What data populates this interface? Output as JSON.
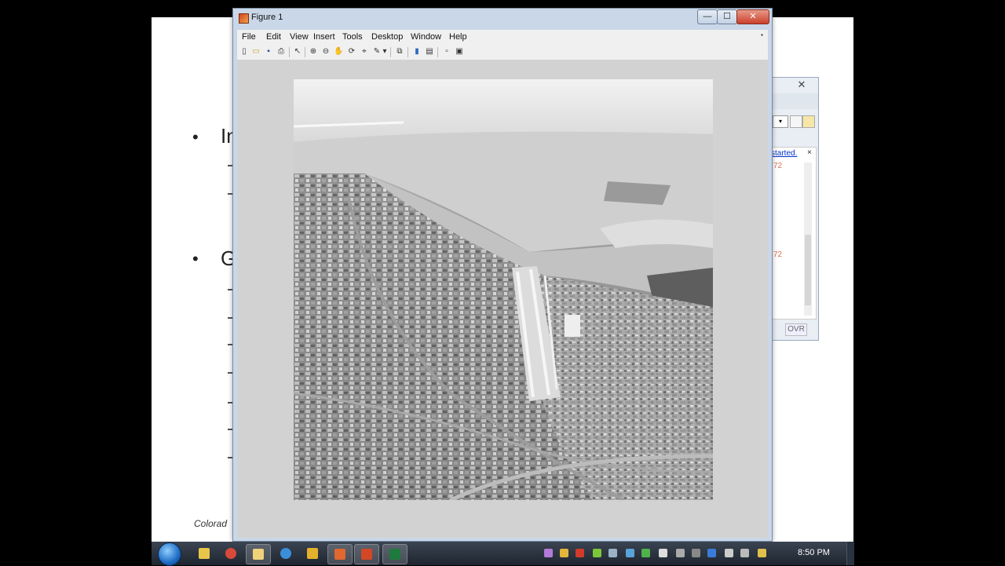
{
  "slide": {
    "bullets": [
      {
        "glyph": "•",
        "text": "In"
      },
      {
        "glyph": "•",
        "text": "G"
      }
    ],
    "footer_text": "Colorad"
  },
  "back_window": {
    "close_glyph": "✕",
    "link_text": "started.",
    "close_pane_glyph": "×",
    "red_text_1": "72",
    "red_text_2": "72",
    "status_ovr": "OVR"
  },
  "figure_window": {
    "title": "Figure 1",
    "controls": {
      "minimize": "—",
      "maximize": "☐",
      "close": "✕"
    },
    "menu": [
      "File",
      "Edit",
      "View",
      "Insert",
      "Tools",
      "Desktop",
      "Window",
      "Help"
    ],
    "menu_corner_glyph": "▪",
    "toolbar": [
      {
        "name": "new-figure-icon",
        "glyph": "▯"
      },
      {
        "name": "open-file-icon",
        "glyph": "▭"
      },
      {
        "name": "save-icon",
        "glyph": "▪"
      },
      {
        "name": "print-icon",
        "glyph": "⎙"
      },
      {
        "name": "select-arrow-icon",
        "glyph": "↖"
      },
      {
        "name": "zoom-in-icon",
        "glyph": "⊕"
      },
      {
        "name": "zoom-out-icon",
        "glyph": "⊖"
      },
      {
        "name": "pan-hand-icon",
        "glyph": "✋"
      },
      {
        "name": "rotate-3d-icon",
        "glyph": "⟳"
      },
      {
        "name": "data-cursor-icon",
        "glyph": "⌖"
      },
      {
        "name": "brush-icon",
        "glyph": "✎"
      },
      {
        "name": "brush-dropdown-icon",
        "glyph": "▾"
      },
      {
        "name": "link-plot-icon",
        "glyph": "⧉"
      },
      {
        "name": "colorbar-icon",
        "glyph": "▮"
      },
      {
        "name": "legend-icon",
        "glyph": "▤"
      },
      {
        "name": "hide-plot-tools-icon",
        "glyph": "▫"
      },
      {
        "name": "show-plot-tools-icon",
        "glyph": "▣"
      }
    ]
  },
  "taskbar": {
    "clock": "8:50 PM",
    "colors": {
      "accent": "#1e6bc4"
    }
  }
}
